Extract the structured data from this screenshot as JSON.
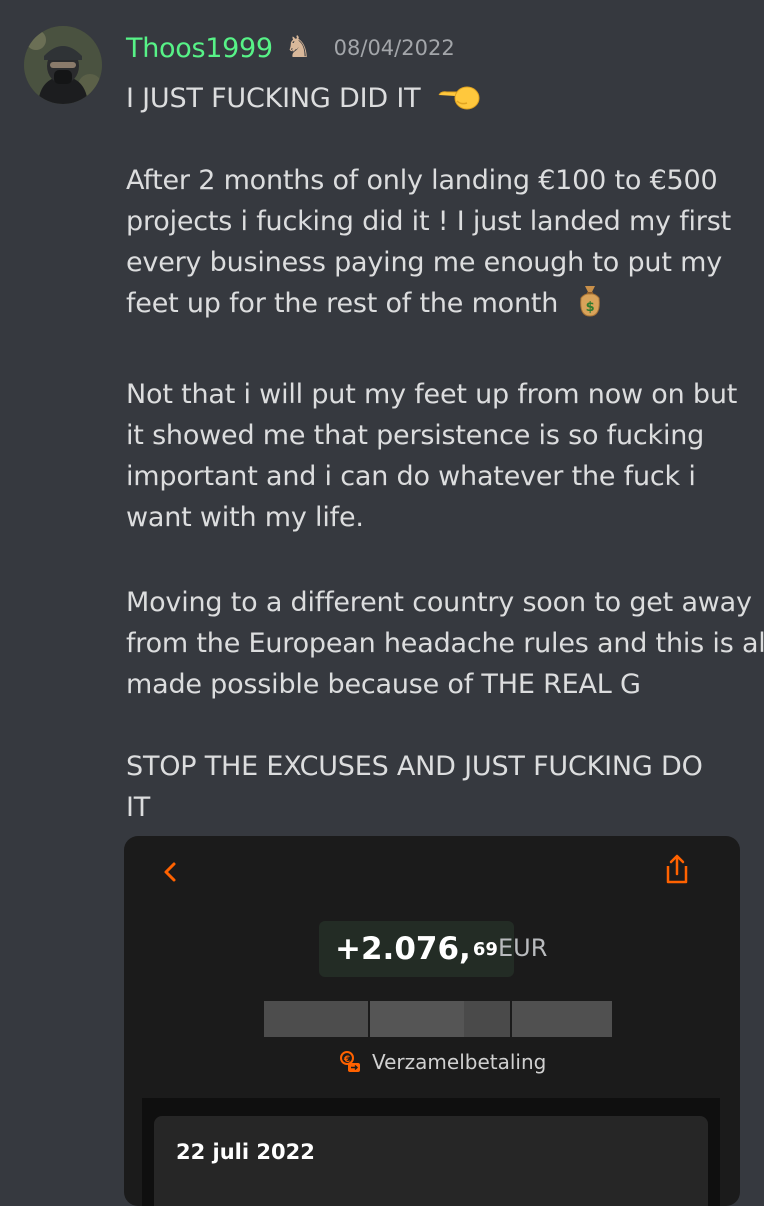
{
  "post": {
    "username": "Thoos1999",
    "timestamp": "08/04/2022",
    "lines": {
      "l1": "I JUST FUCKING DID IT",
      "l2": "After 2 months of only landing €100 to €500",
      "l3": "projects i fucking did it ! I just landed my first",
      "l4": "every business paying me enough to put my",
      "l5": "feet up for the rest of the month",
      "l6": "Not that i will put my feet up from now on but",
      "l7": "it showed me that persistence is so fucking",
      "l8": "important and i can do whatever the fuck i",
      "l9": "want with my life.",
      "l10": "Moving to a different country soon to get away",
      "l11": "from the European headache rules and this is al",
      "l12": "made possible because of THE REAL G",
      "l13": "STOP THE EXCUSES AND JUST FUCKING DO",
      "l14": "IT"
    },
    "icons": {
      "role_badge": "chess-knight-icon",
      "emoji_1": "pointing-left-hand-emoji",
      "emoji_2": "money-bag-emoji"
    }
  },
  "attachment": {
    "amount_main": "+2.076,",
    "amount_cents": "69",
    "currency": "EUR",
    "payment_type": "Verzamelbetaling",
    "date": "22 juli 2022",
    "icons": {
      "back": "chevron-left-icon",
      "share": "share-icon",
      "payment": "collective-payment-icon"
    }
  },
  "colors": {
    "background": "#36393f",
    "username": "#57f287",
    "accent_orange": "#ff6200"
  }
}
